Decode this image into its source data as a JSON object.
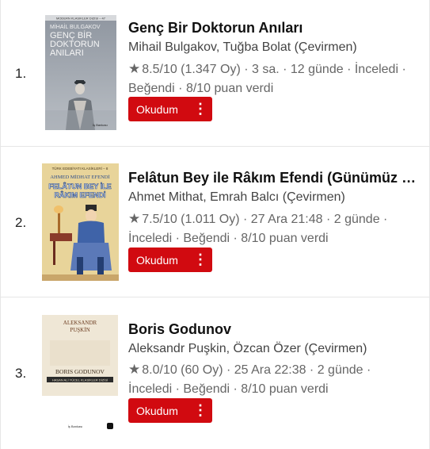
{
  "books": [
    {
      "rank": "1.",
      "title": "Genç Bir Doktorun Anıları",
      "authors": "Mihail Bulgakov, Tuğba Bolat (Çevirmen)",
      "meta": "8.5/10 (1.347 Oy) · 3 sa. · 12 günde · İnceledi · Beğendi · 8/10 puan verdi",
      "button_label": "Okudum",
      "cover": {
        "series": "MODERN KLASIKLER DIZISI – 47",
        "author": "MİHAİL BULGAKOV",
        "title_lines": [
          "GENÇ BİR",
          "DOKTORUN",
          "ANILARI"
        ],
        "publisher": "İş Bankası"
      }
    },
    {
      "rank": "2.",
      "title": "Felâtun Bey ile Râkım Efendi (Günümüz Türkçesiyle)",
      "authors": "Ahmet Mithat, Emrah Balcı (Çevirmen)",
      "meta": "7.5/10 (1.011 Oy) · 27 Ara 21:48 · 2 günde · İnceledi · Beğendi · 8/10 puan verdi",
      "button_label": "Okudum",
      "cover": {
        "series": "TÜRK EDEBİYATI KLASİKLERİ – 8",
        "author": "AHMED MİDHAT EFENDİ",
        "title_lines": [
          "FELÂTUN BEY İLE",
          "RÂKIM EFENDİ"
        ]
      }
    },
    {
      "rank": "3.",
      "title": "Boris Godunov",
      "authors": "Aleksandr Puşkin, Özcan Özer (Çevirmen)",
      "meta": "8.0/10 (60 Oy) · 25 Ara 22:38 · 2 günde · İnceledi · Beğendi · 8/10 puan verdi",
      "button_label": "Okudum",
      "cover": {
        "author_lines": [
          "ALEKSANDR",
          "PUŞKİN"
        ],
        "title": "BORIS GODUNOV",
        "series": "HASAN ALİ YÜCEL KLASİKLER DİZİSİ",
        "publisher": "İş Bankası"
      }
    }
  ]
}
